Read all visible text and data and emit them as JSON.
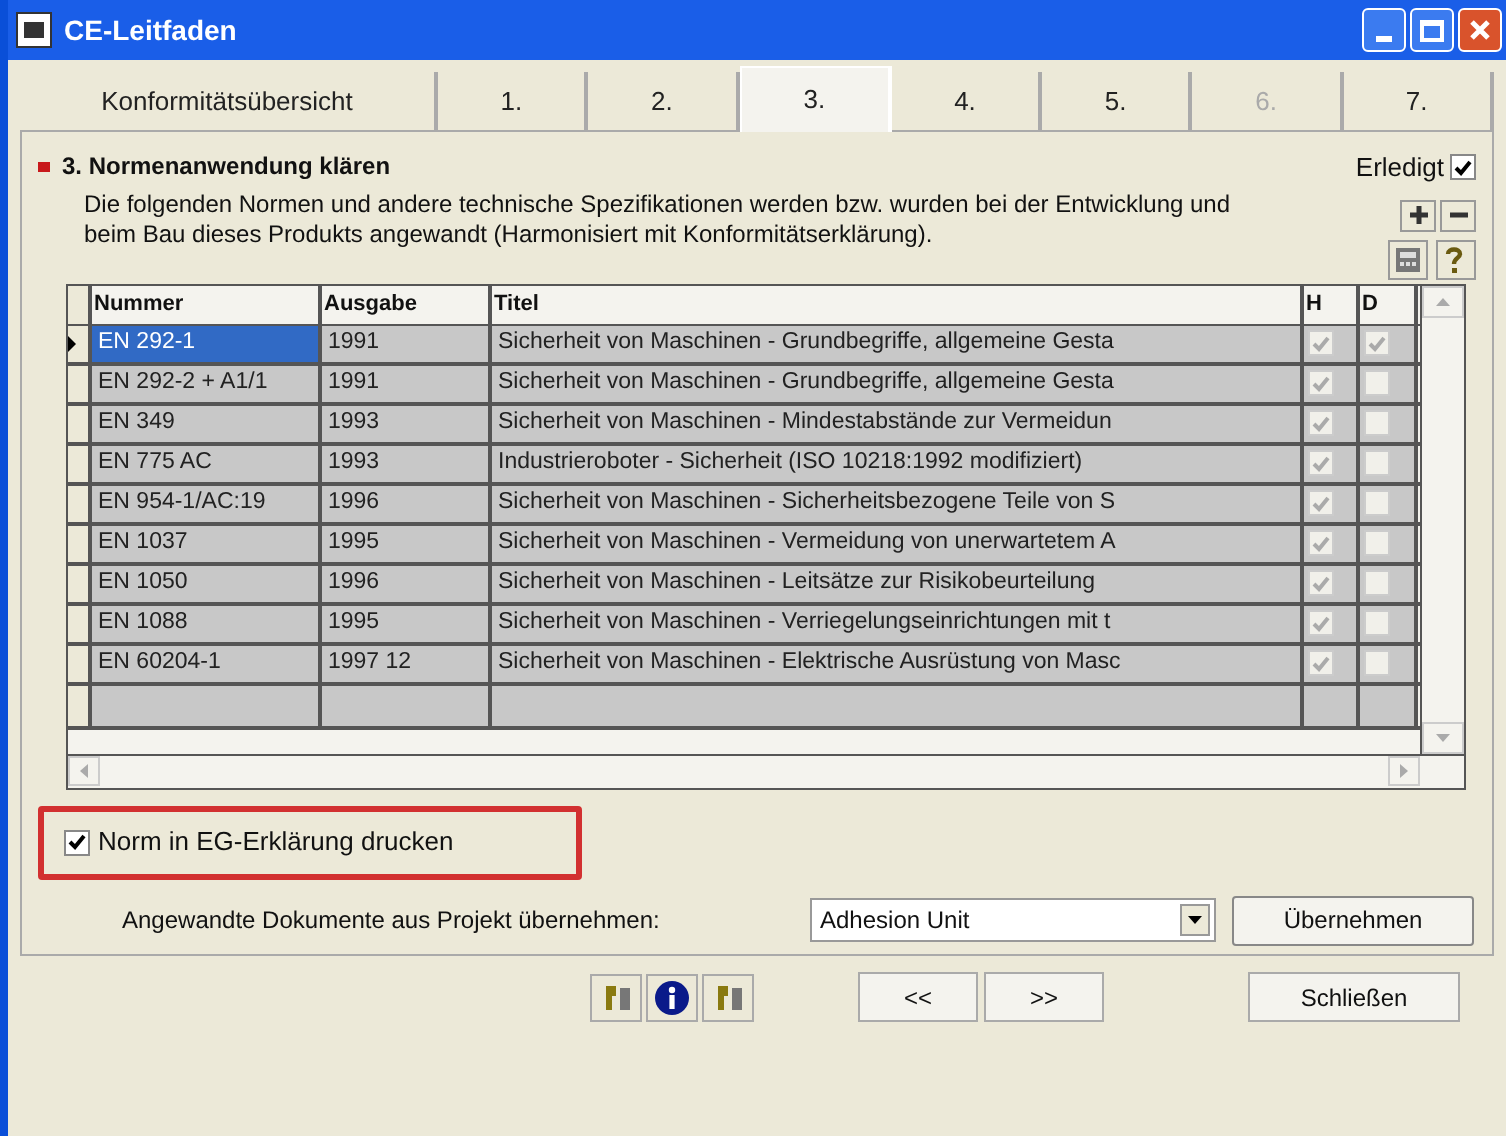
{
  "window": {
    "title": "CE-Leitfaden"
  },
  "tabs": [
    {
      "label": "Konformitätsübersicht",
      "selected": false,
      "disabled": false
    },
    {
      "label": "1.",
      "selected": false,
      "disabled": false
    },
    {
      "label": "2.",
      "selected": false,
      "disabled": false
    },
    {
      "label": "3.",
      "selected": true,
      "disabled": false
    },
    {
      "label": "4.",
      "selected": false,
      "disabled": false
    },
    {
      "label": "5.",
      "selected": false,
      "disabled": false
    },
    {
      "label": "6.",
      "selected": false,
      "disabled": true
    },
    {
      "label": "7.",
      "selected": false,
      "disabled": false
    }
  ],
  "section": {
    "title": "3. Normenanwendung klären",
    "done_label": "Erledigt",
    "done_checked": true,
    "description": "Die folgenden Normen und andere technische Spezifikationen werden bzw. wurden bei der Entwicklung und beim Bau dieses Produkts angewandt (Harmonisiert mit Konformitätserklärung)."
  },
  "table": {
    "columns": [
      "Nummer",
      "Ausgabe",
      "Titel",
      "H",
      "D"
    ],
    "rows": [
      {
        "nummer": "EN 292-1",
        "ausgabe": "1991",
        "titel": "Sicherheit von Maschinen - Grundbegriffe, allgemeine Gesta",
        "h": true,
        "d": true,
        "selected": true
      },
      {
        "nummer": "EN 292-2 + A1/1",
        "ausgabe": "1991",
        "titel": "Sicherheit von Maschinen - Grundbegriffe, allgemeine Gesta",
        "h": true,
        "d": false,
        "selected": false
      },
      {
        "nummer": "EN 349",
        "ausgabe": "1993",
        "titel": "Sicherheit von Maschinen - Mindestabstände zur Vermeidun",
        "h": true,
        "d": false,
        "selected": false
      },
      {
        "nummer": "EN 775 AC",
        "ausgabe": "1993",
        "titel": "Industrieroboter - Sicherheit (ISO 10218:1992 modifiziert)",
        "h": true,
        "d": false,
        "selected": false
      },
      {
        "nummer": "EN 954-1/AC:19",
        "ausgabe": "1996",
        "titel": "Sicherheit von Maschinen - Sicherheitsbezogene Teile von S",
        "h": true,
        "d": false,
        "selected": false
      },
      {
        "nummer": "EN 1037",
        "ausgabe": "1995",
        "titel": "Sicherheit von Maschinen - Vermeidung von unerwartetem A",
        "h": true,
        "d": false,
        "selected": false
      },
      {
        "nummer": "EN 1050",
        "ausgabe": "1996",
        "titel": "Sicherheit von Maschinen - Leitsätze zur Risikobeurteilung",
        "h": true,
        "d": false,
        "selected": false
      },
      {
        "nummer": "EN 1088",
        "ausgabe": "1995",
        "titel": "Sicherheit von Maschinen - Verriegelungseinrichtungen mit t",
        "h": true,
        "d": false,
        "selected": false
      },
      {
        "nummer": "EN 60204-1",
        "ausgabe": "1997 12",
        "titel": "Sicherheit von Maschinen - Elektrische Ausrüstung von Masc",
        "h": true,
        "d": false,
        "selected": false
      }
    ]
  },
  "print_option": {
    "label": "Norm in EG-Erklärung drucken",
    "checked": true
  },
  "import": {
    "label": "Angewandte Dokumente aus Projekt übernehmen:",
    "value": "Adhesion Unit",
    "button": "Übernehmen"
  },
  "footer": {
    "prev": "<<",
    "next": ">>",
    "close": "Schließen"
  }
}
